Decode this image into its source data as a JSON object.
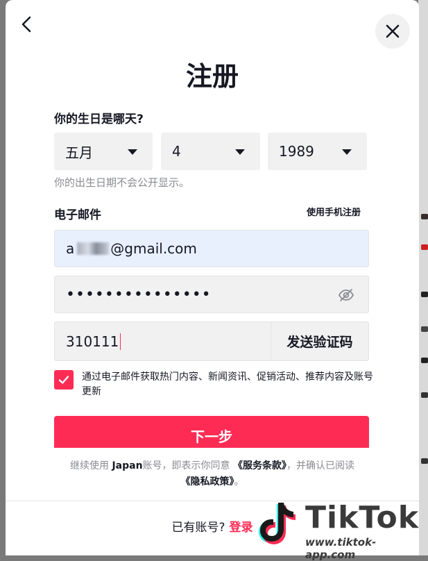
{
  "page_title": "注册",
  "birthday": {
    "label": "你的生日是哪天?",
    "month": "五月",
    "day": "4",
    "year": "1989",
    "hint": "你的出生日期不会公开显示。"
  },
  "email": {
    "label": "电子邮件",
    "switch_link": "使用手机注册",
    "value_prefix": "a",
    "value_suffix": "@gmail.com",
    "password_masked": "•••••••••••••••",
    "code_value": "310111",
    "send_code_label": "发送验证码"
  },
  "consent": {
    "checked": true,
    "text": "通过电子邮件获取热门内容、新闻资讯、促销活动、推荐内容及账号更新"
  },
  "next_button": "下一步",
  "legal": {
    "part1": "继续使用 ",
    "app_name": "Japan",
    "part2": "账号，即表示你同意",
    "terms": "《服务条款》",
    "part3": "，并确认已阅读",
    "privacy": "《隐私政策》",
    "part4": "。"
  },
  "footer": {
    "prompt": "已有账号?",
    "login_link": "登录"
  },
  "watermark": {
    "brand": "TikTok",
    "url": "www.tiktok-app.com"
  },
  "colors": {
    "accent": "#fe2c55",
    "text": "#161823",
    "muted": "#8a8b91",
    "field_bg": "#f1f1f2",
    "autofill_bg": "#e8f0fe"
  },
  "icons": {
    "back": "chevron-left-icon",
    "close": "close-icon",
    "dropdown": "caret-down-icon",
    "password_toggle": "eye-off-icon",
    "checkbox": "check-icon"
  }
}
